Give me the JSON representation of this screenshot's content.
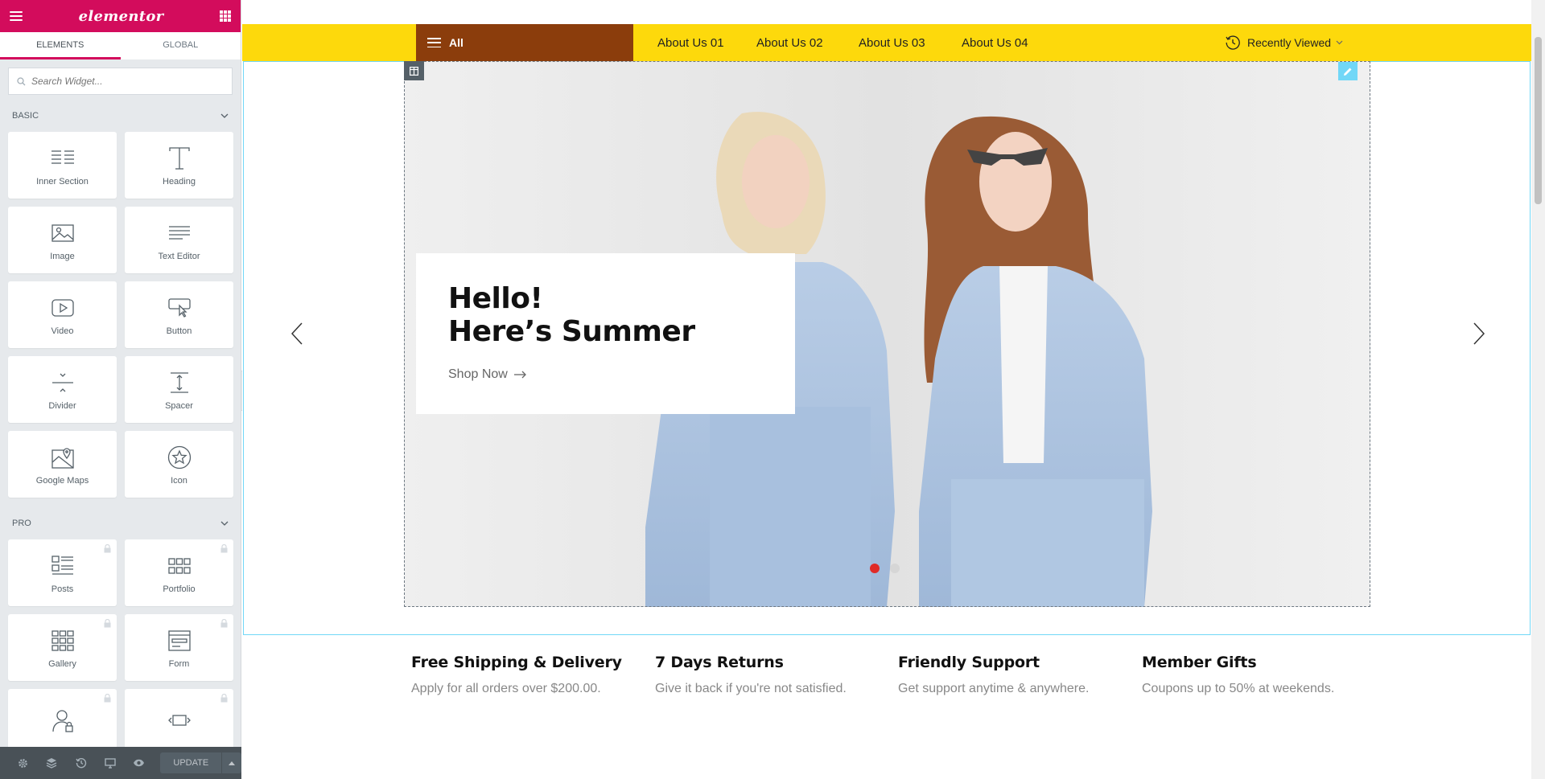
{
  "panel": {
    "logo": "elementor",
    "tabs": [
      "ELEMENTS",
      "GLOBAL"
    ],
    "search_placeholder": "Search Widget...",
    "categories": [
      {
        "title": "BASIC",
        "widgets": [
          {
            "label": "Inner Section",
            "icon": "inner-section-icon"
          },
          {
            "label": "Heading",
            "icon": "heading-icon"
          },
          {
            "label": "Image",
            "icon": "image-icon"
          },
          {
            "label": "Text Editor",
            "icon": "text-editor-icon"
          },
          {
            "label": "Video",
            "icon": "video-icon"
          },
          {
            "label": "Button",
            "icon": "button-icon"
          },
          {
            "label": "Divider",
            "icon": "divider-icon"
          },
          {
            "label": "Spacer",
            "icon": "spacer-icon"
          },
          {
            "label": "Google Maps",
            "icon": "google-maps-icon"
          },
          {
            "label": "Icon",
            "icon": "star-icon"
          }
        ]
      },
      {
        "title": "PRO",
        "widgets": [
          {
            "label": "Posts",
            "icon": "posts-icon"
          },
          {
            "label": "Portfolio",
            "icon": "portfolio-icon"
          },
          {
            "label": "Gallery",
            "icon": "gallery-icon"
          },
          {
            "label": "Form",
            "icon": "form-icon"
          },
          {
            "label": "",
            "icon": "login-icon"
          },
          {
            "label": "",
            "icon": "slides-icon"
          }
        ]
      }
    ],
    "footer": {
      "update_label": "UPDATE"
    }
  },
  "site": {
    "nav": {
      "all_label": "All",
      "links": [
        "About Us 01",
        "About Us 02",
        "About Us 03",
        "About Us 04"
      ],
      "recently_viewed": "Recently Viewed"
    },
    "hero": {
      "title_line1": "Hello!",
      "title_line2": "Here’s Summer",
      "cta": "Shop Now",
      "slides_total": 2,
      "active_slide": 1
    },
    "features": [
      {
        "title": "Free Shipping & Delivery",
        "text": "Apply for all orders over $200.00."
      },
      {
        "title": "7 Days Returns",
        "text": "Give it back if you're not satisfied."
      },
      {
        "title": "Friendly Support",
        "text": "Get support anytime & anywhere."
      },
      {
        "title": "Member Gifts",
        "text": "Coupons up to 50% at weekends."
      }
    ]
  },
  "colors": {
    "elementor_brand": "#d30c5c",
    "nav_bar": "#fdd90c",
    "all_button": "#8b3d0c",
    "active_dot": "#e02b27",
    "editor_outline": "#71d7f7"
  }
}
